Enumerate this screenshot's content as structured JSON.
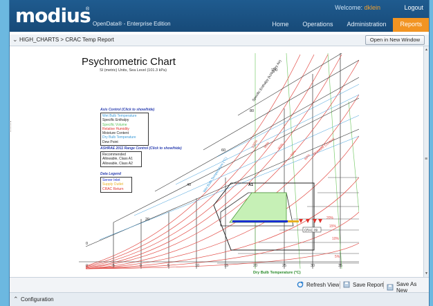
{
  "app": {
    "logo_text": "modius",
    "edition": "OpenData® - Enterprise Edition",
    "welcome_prefix": "Welcome:",
    "user": "dklein",
    "logout": "Logout"
  },
  "nav": {
    "items": [
      {
        "label": "Home",
        "active": false
      },
      {
        "label": "Operations",
        "active": false
      },
      {
        "label": "Administration",
        "active": false
      },
      {
        "label": "Reports",
        "active": true
      }
    ]
  },
  "breadcrumb": "HIGH_CHARTS > CRAC Temp Report",
  "open_new_window": "Open in New Window",
  "chart": {
    "title": "Psychrometric Chart",
    "subtitle": "SI (metric) Units, Sea Level (101.3 kPa)",
    "axis_control": {
      "heading": "Axis Control (Click to show/hide)",
      "items": [
        {
          "label": "Wet Bulb Temperature",
          "color": "#3a9ad8"
        },
        {
          "label": "Specific Enthalpy",
          "color": "#222222"
        },
        {
          "label": "Specific Volume",
          "color": "#5cc25c"
        },
        {
          "label": "Relative Humidity",
          "color": "#e0302a"
        },
        {
          "label": "Moisture Content",
          "color": "#222222"
        },
        {
          "label": "Dry Bulb Temperature",
          "color": "#3a9ad8"
        },
        {
          "label": "Dew Point",
          "color": "#222222"
        }
      ]
    },
    "ashrae_control": {
      "heading": "ASHRAE 2011 Range Control (Click to show/hide)",
      "items": [
        {
          "label": "Recommended",
          "color": "#222222"
        },
        {
          "label": "Allowable, Class A1",
          "color": "#222222"
        },
        {
          "label": "Allowable, Class A2",
          "color": "#222222"
        }
      ]
    },
    "data_legend": {
      "heading": "Data Legend",
      "items": [
        {
          "label": "Server Inlet",
          "color": "#1a2fd0"
        },
        {
          "label": "Supply Outlet",
          "color": "#e8b020"
        },
        {
          "label": "CRAC Return",
          "color": "#e0302a"
        }
      ]
    },
    "x_axis_label": "Dry Bulb Temperature (°C)",
    "x_ticks": [
      "0",
      "-5",
      "0",
      "5",
      "10",
      "15",
      "20",
      "25",
      "30",
      "35"
    ],
    "wetbulb_axis_label": "Wet Bulb Temperature (°C)",
    "enthalpy_axis_label": "Specific Enthalpy (kJ/kg Dry Air)",
    "moisture_axis_label": "Moisture Content",
    "enthalpy_ticks": [
      "100",
      "80",
      "60",
      "40",
      "20",
      "0"
    ],
    "rh_labels": [
      "100%",
      "90%",
      "80%",
      "70%",
      "60%"
    ],
    "rh_right_labels": [
      "20%",
      "15%",
      "10%",
      "5%"
    ],
    "region_label": "A1",
    "point_label": "CRAC 09"
  },
  "toolbar": {
    "refresh": "Refresh View",
    "save_report": "Save Report",
    "save_as_new": "Save As New"
  },
  "configuration": "Configuration"
}
